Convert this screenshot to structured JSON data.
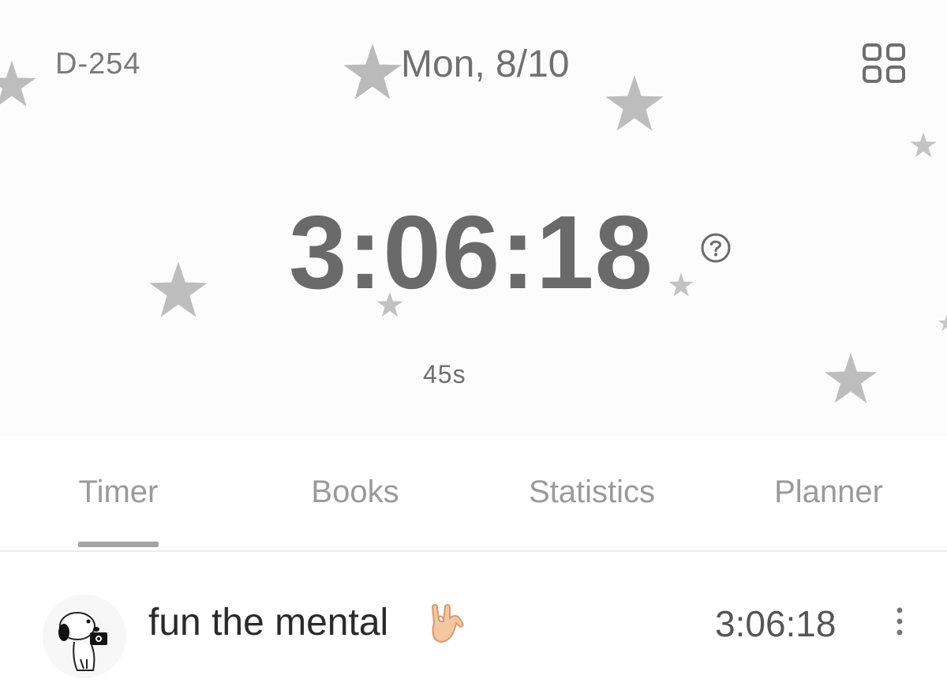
{
  "header": {
    "dday": "D-254",
    "date": "Mon, 8/10",
    "menu_icon": "grid-icon"
  },
  "timer": {
    "total": "3:06:18",
    "seconds": "45s",
    "help_icon": "question-circle-icon"
  },
  "tabs": [
    {
      "label": "Timer",
      "active": true
    },
    {
      "label": "Books",
      "active": false
    },
    {
      "label": "Statistics",
      "active": false
    },
    {
      "label": "Planner",
      "active": false
    }
  ],
  "subjects": [
    {
      "name": "fun the mental",
      "emoji_icon": "sign-of-horns-hand-icon",
      "time": "3:06:18",
      "avatar_icon": "snoopy-camera-avatar"
    }
  ],
  "colors": {
    "star": "#b9b9b9",
    "text_gray": "#6a6a6a",
    "tab_active_underline": "#a3a3a3"
  }
}
